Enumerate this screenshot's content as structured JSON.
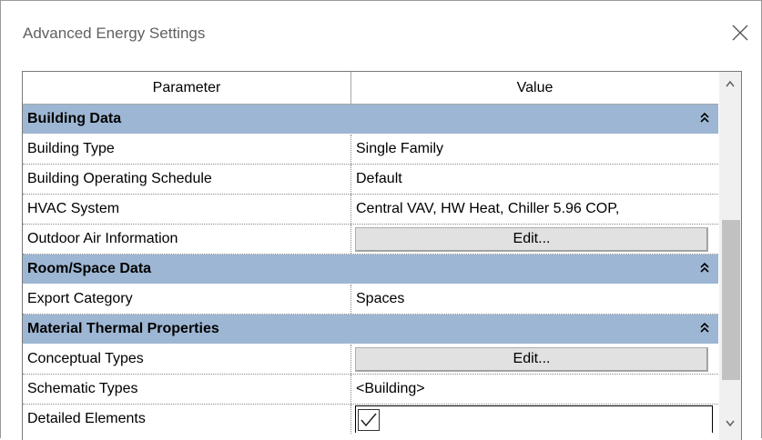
{
  "window": {
    "title": "Advanced Energy Settings",
    "close_icon": "close-icon"
  },
  "grid": {
    "columns": {
      "parameter": "Parameter",
      "value": "Value"
    },
    "groups": [
      {
        "label": "Building Data",
        "rows": [
          {
            "param": "Building Type",
            "value": "Single Family"
          },
          {
            "param": "Building Operating Schedule",
            "value": "Default"
          },
          {
            "param": "HVAC System",
            "value": "Central VAV, HW Heat, Chiller 5.96 COP,"
          },
          {
            "param": "Outdoor Air Information",
            "value": "Edit..."
          }
        ]
      },
      {
        "label": "Room/Space Data",
        "rows": [
          {
            "param": "Export Category",
            "value": "Spaces"
          }
        ]
      },
      {
        "label": "Material Thermal Properties",
        "rows": [
          {
            "param": "Conceptual Types",
            "value": "Edit..."
          },
          {
            "param": "Schematic Types",
            "value": "<Building>"
          },
          {
            "param": "Detailed Elements",
            "checked": true
          }
        ]
      }
    ]
  },
  "colors": {
    "group_header": "#9db6d3",
    "button_face": "#e1e1e1",
    "scrollbar_thumb": "#c1c1c1"
  }
}
